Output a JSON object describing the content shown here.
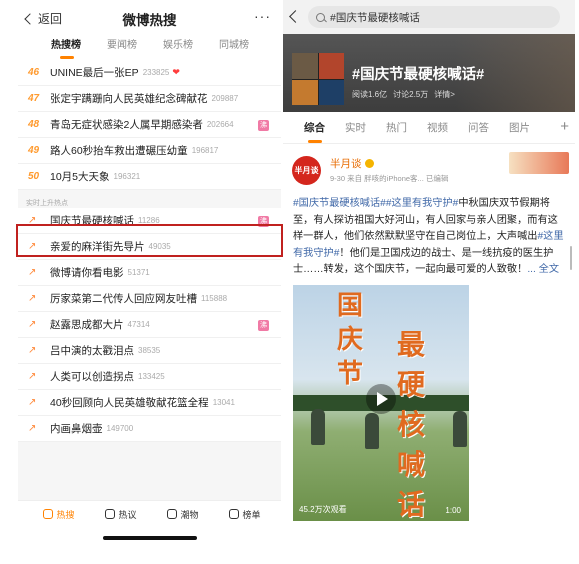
{
  "left": {
    "back_label": "返回",
    "title": "微博热搜",
    "more": "···",
    "tabs": [
      "热搜榜",
      "要闻榜",
      "娱乐榜",
      "同城榜"
    ],
    "ranked": [
      {
        "rank": "46",
        "title": "UNINE最后一张EP",
        "count": "233825",
        "heart": "❤"
      },
      {
        "rank": "47",
        "title": "张定宇蹒跚向人民英雄纪念碑献花",
        "count": "209887"
      },
      {
        "rank": "48",
        "title": "青岛无症状感染2人属早期感染者",
        "count": "202664",
        "badge": "沸"
      },
      {
        "rank": "49",
        "title": "路人60秒抬车救出遭碾压幼童",
        "count": "196817"
      },
      {
        "rank": "50",
        "title": "10月5大天象",
        "count": "196321"
      }
    ],
    "section_label": "实时上升热点",
    "rising": [
      {
        "title": "国庆节最硬核喊话",
        "count": "11286",
        "badge": "沸"
      },
      {
        "title": "亲爱的麻洋街先导片",
        "count": "49035"
      },
      {
        "title": "微博请你看电影",
        "count": "51371"
      },
      {
        "title": "厉家菜第二代传人回应网友吐槽",
        "count": "115888"
      },
      {
        "title": "赵露思成都大片",
        "count": "47314",
        "badge": "沸"
      },
      {
        "title": "吕中演的太戳泪点",
        "count": "38535"
      },
      {
        "title": "人类可以创造拐点",
        "count": "133425"
      },
      {
        "title": "40秒回顾向人民英雄敬献花篮全程",
        "count": "13041"
      },
      {
        "title": "内画鼻烟壶",
        "count": "149700"
      }
    ],
    "rising_arrow": "↗",
    "bottom": [
      "热搜",
      "热议",
      "潮物",
      "榜单"
    ]
  },
  "right": {
    "search_query": "#国庆节最硬核喊话",
    "topic_name": "#国庆节最硬核喊话#",
    "reads": "阅读1.6亿",
    "discussions": "讨论2.5万",
    "details": "详情>",
    "tabs": [
      "综合",
      "实时",
      "热门",
      "视频",
      "问答",
      "图片"
    ],
    "plus": "+",
    "post": {
      "avatar_text": "半月谈",
      "author": "半月谈",
      "meta": "9-30  来自 胖咳的iPhone客...  已编辑",
      "tag1": "#国庆节最硬核喊话#",
      "tag2": "#这里有我守护#",
      "text1": "中秋国庆双节假期将至，有人探访祖国大好河山，有人回家与亲人团聚，而有这样一群人，他们依然默默坚守在自己岗位上，大声喊出",
      "tag3": "#这里有我守护#",
      "text2": "！他们是卫国戍边的战士、是一线抗疫的医生护士……转发，这个国庆节，一起向最可爱的人致敬！",
      "more": "... 全文",
      "video_chars_left": [
        "国",
        "庆",
        "节"
      ],
      "video_chars_right": [
        "最",
        "硬",
        "核",
        "喊",
        "话"
      ],
      "video_views": "45.2万次观看",
      "video_duration": "1:00"
    }
  },
  "colors": {
    "accent": "#ff8200",
    "highlight_box": "#c0211f",
    "link": "#4169a8",
    "rank_number": "#ff9a2e"
  }
}
